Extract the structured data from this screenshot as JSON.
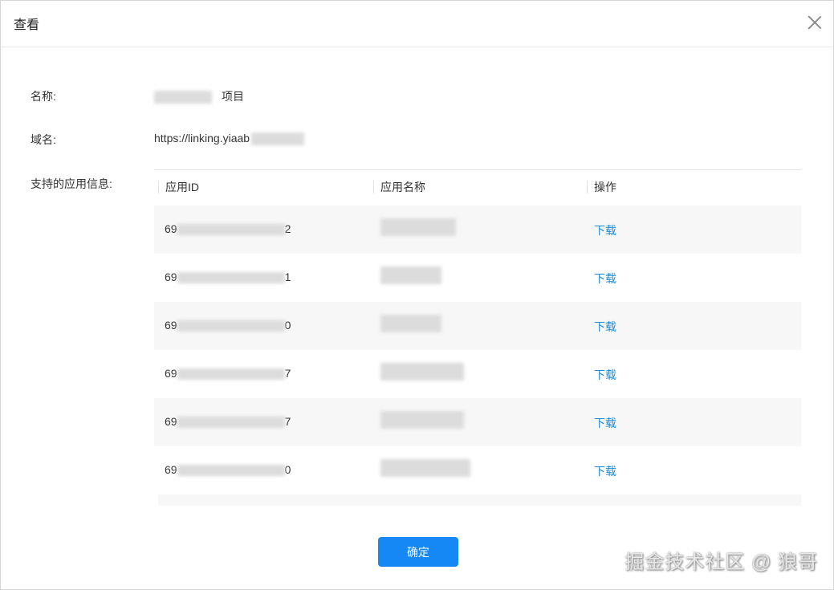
{
  "dialog": {
    "title": "查看",
    "fields": {
      "name_label": "名称:",
      "name_suffix": "项目",
      "domain_label": "域名:",
      "domain_value": "https://linking.yiaab",
      "apps_label": "支持的应用信息:"
    },
    "table": {
      "columns": [
        "应用ID",
        "应用名称",
        "操作"
      ],
      "rows": [
        {
          "id_prefix": "69",
          "id_suffix": "2",
          "action": "下载"
        },
        {
          "id_prefix": "69",
          "id_suffix": "1",
          "action": "下载"
        },
        {
          "id_prefix": "69",
          "id_suffix": "0",
          "action": "下载"
        },
        {
          "id_prefix": "69",
          "id_suffix": "7",
          "action": "下载"
        },
        {
          "id_prefix": "69",
          "id_suffix": "7",
          "action": "下载"
        },
        {
          "id_prefix": "69",
          "id_suffix": "0",
          "action": "下载"
        }
      ]
    },
    "ok_label": "确定"
  },
  "watermark": "掘金技术社区 @ 狼哥",
  "colors": {
    "primary": "#1688f5",
    "link": "#1a8cd8",
    "row_alt": "#f7f7f7"
  }
}
